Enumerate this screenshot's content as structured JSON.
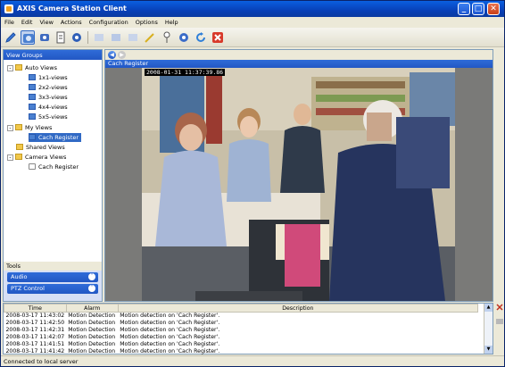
{
  "window": {
    "title": "AXIS Camera Station Client"
  },
  "menu": [
    "File",
    "Edit",
    "View",
    "Actions",
    "Configuration",
    "Options",
    "Help"
  ],
  "left_panel": {
    "header": "View Groups",
    "tree": {
      "auto_views": "Auto Views",
      "views": [
        "1x1-views",
        "2x2-views",
        "3x3-views",
        "4x4-views",
        "5x5-views"
      ],
      "my_views": "My Views",
      "my_views_child": "Cach Register",
      "shared_views": "Shared Views",
      "camera_views": "Camera Views",
      "camera_views_child": "Cach Register"
    }
  },
  "tools": {
    "header": "Tools",
    "items": [
      "Audio",
      "PTZ Control"
    ]
  },
  "camera": {
    "name": "Cach Register",
    "timestamp": "2008-01-31 11:37:39.86"
  },
  "alarms": {
    "columns": [
      "Time",
      "Alarm",
      "Description"
    ],
    "rows": [
      {
        "time": "2008-03-17 11:43:02",
        "alarm": "Motion Detection",
        "description": "Motion detection on 'Cach Register'."
      },
      {
        "time": "2008-03-17 11:42:50",
        "alarm": "Motion Detection",
        "description": "Motion detection on 'Cach Register'."
      },
      {
        "time": "2008-03-17 11:42:31",
        "alarm": "Motion Detection",
        "description": "Motion detection on 'Cach Register'."
      },
      {
        "time": "2008-03-17 11:42:07",
        "alarm": "Motion Detection",
        "description": "Motion detection on 'Cach Register'."
      },
      {
        "time": "2008-03-17 11:41:51",
        "alarm": "Motion Detection",
        "description": "Motion detection on 'Cach Register'."
      },
      {
        "time": "2008-03-17 11:41:42",
        "alarm": "Motion Detection",
        "description": "Motion detection on 'Cach Register'."
      }
    ]
  },
  "status": "Connected to local server",
  "icons": {
    "titlebar": [
      "minimize-icon",
      "maximize-icon",
      "close-icon"
    ],
    "toolbar": [
      "pencil-icon",
      "live-view-icon",
      "camera-config-icon",
      "recordings-icon",
      "settings-gear-icon",
      "add-icon",
      "edit-icon",
      "copy-icon",
      "wand-icon",
      "ptz-icon",
      "network-icon",
      "refresh-icon",
      "delete-icon"
    ]
  },
  "colors": {
    "accent": "#2257c4",
    "titlebar": "#0a5fe0",
    "selection": "#316ac5"
  }
}
